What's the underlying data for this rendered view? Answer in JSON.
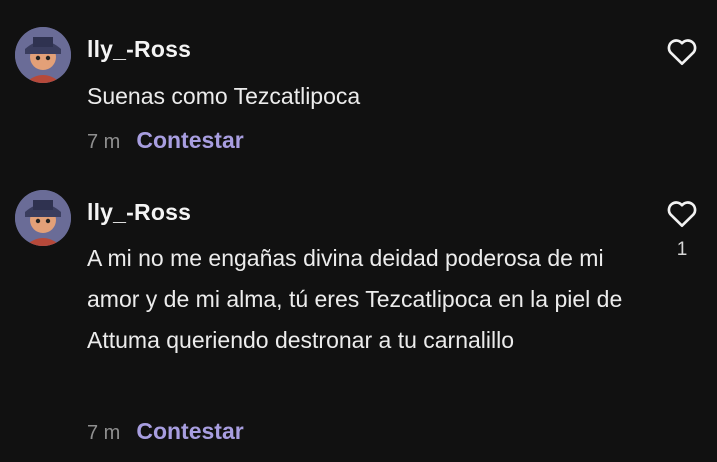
{
  "comments": [
    {
      "username": "lly_-Ross",
      "text": "Suenas como Tezcatlipoca",
      "time": "7 m",
      "reply_label": "Contestar",
      "likes": "",
      "icon": "heart-outline-icon"
    },
    {
      "username": "lly_-Ross",
      "text": "A mi no me engañas divina deidad poderosa de mi amor y de mi alma, tú eres Tezcatlipoca en la piel de Attuma queriendo destronar a tu carnalillo",
      "time": "7 m",
      "reply_label": "Contestar",
      "likes": "1",
      "icon": "heart-outline-icon"
    }
  ],
  "colors": {
    "background": "#111111",
    "reply_accent": "#a89ee0",
    "muted": "#8f8f8f"
  }
}
